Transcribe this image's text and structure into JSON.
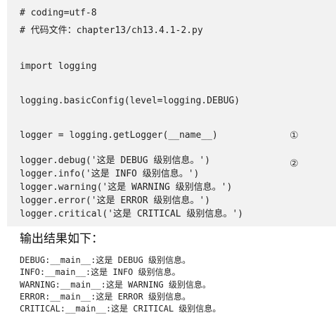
{
  "code": {
    "lines": [
      "# coding=utf-8",
      "# 代码文件：chapter13/ch13.4.1-2.py",
      "import logging",
      "logging.basicConfig(level=logging.DEBUG)",
      "logger = logging.getLogger(__name__)",
      "logger.debug('这是 DEBUG 级别信息。')",
      "logger.info('这是 INFO 级别信息。')",
      "logger.warning('这是 WARNING 级别信息。')",
      "logger.error('这是 ERROR 级别信息。')",
      "logger.critical('这是 CRITICAL 级别信息。')"
    ],
    "markers": [
      "①",
      "②"
    ]
  },
  "output": {
    "heading": "输出结果如下：",
    "lines": [
      "DEBUG:__main__:这是 DEBUG 级别信息。",
      "INFO:__main__:这是 INFO 级别信息。",
      "WARNING:__main__:这是 WARNING 级别信息。",
      "ERROR:__main__:这是 ERROR 级别信息。",
      "CRITICAL:__main__:这是 CRITICAL 级别信息。"
    ]
  }
}
